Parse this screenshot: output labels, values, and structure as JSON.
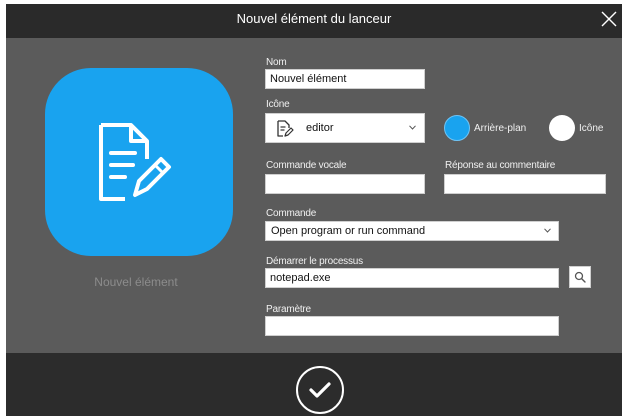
{
  "window": {
    "title": "Nouvel élément du lanceur"
  },
  "preview": {
    "caption": "Nouvel élément",
    "tile_color": "#19a3ef",
    "icon": "document-edit-icon"
  },
  "form": {
    "name": {
      "label": "Nom",
      "value": "Nouvel élément"
    },
    "icon": {
      "label": "Icône",
      "selected": "editor",
      "selected_icon": "document-edit-icon"
    },
    "colors": {
      "background": {
        "label": "Arrière-plan",
        "value": "#19a3ef"
      },
      "foreground": {
        "label": "Icône",
        "value": "#ffffff"
      }
    },
    "voice_command": {
      "label": "Commande vocale",
      "value": ""
    },
    "response": {
      "label": "Réponse au commentaire",
      "value": ""
    },
    "command": {
      "label": "Commande",
      "selected": "Open program or run command"
    },
    "process": {
      "label": "Démarrer le processus",
      "value": "notepad.exe",
      "browse_icon": "search-icon"
    },
    "parameter": {
      "label": "Paramètre",
      "value": ""
    }
  },
  "footer": {
    "confirm_icon": "checkmark-icon"
  }
}
